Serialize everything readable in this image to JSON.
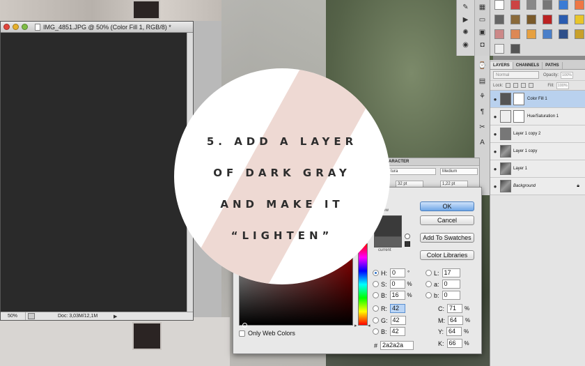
{
  "document": {
    "title": "IMG_4851.JPG @ 50% (Color Fill 1, RGB/8) *",
    "zoom": "50%",
    "doc_info": "Doc: 3,03M/12,1M"
  },
  "layers_panel": {
    "tabs": [
      "LAYERS",
      "CHANNELS",
      "PATHS"
    ],
    "blend_mode": "Normal",
    "opacity_label": "Opacity:",
    "opacity_value": "100%",
    "lock_label": "Lock:",
    "fill_label": "Fill:",
    "fill_value": "100%",
    "layers": [
      {
        "name": "Color Fill 1",
        "selected": true
      },
      {
        "name": "Hue/Saturation 1",
        "selected": false
      },
      {
        "name": "Layer 1 copy 2",
        "selected": false
      },
      {
        "name": "Layer 1 copy",
        "selected": false
      },
      {
        "name": "Layer 1",
        "selected": false
      },
      {
        "name": "Background",
        "selected": false
      }
    ]
  },
  "character_panel": {
    "title": "ARACTER",
    "font": "tura",
    "style": "Medium",
    "size": "32 pt",
    "leading": "1,22 pt"
  },
  "color_picker": {
    "new_label": "new",
    "current_label": "current",
    "ok": "OK",
    "cancel": "Cancel",
    "add_to_swatches": "Add To Swatches",
    "color_libraries": "Color Libraries",
    "only_web_colors": "Only Web Colors",
    "h": {
      "label": "H:",
      "value": "0",
      "unit": "°"
    },
    "s": {
      "label": "S:",
      "value": "0",
      "unit": "%"
    },
    "b": {
      "label": "B:",
      "value": "16",
      "unit": "%"
    },
    "r": {
      "label": "R:",
      "value": "42"
    },
    "g": {
      "label": "G:",
      "value": "42"
    },
    "bl": {
      "label": "B:",
      "value": "42"
    },
    "l": {
      "label": "L:",
      "value": "17"
    },
    "a": {
      "label": "a:",
      "value": "0"
    },
    "lb": {
      "label": "b:",
      "value": "0"
    },
    "c": {
      "label": "C:",
      "value": "71",
      "unit": "%"
    },
    "m": {
      "label": "M:",
      "value": "64",
      "unit": "%"
    },
    "y": {
      "label": "Y:",
      "value": "64",
      "unit": "%"
    },
    "k": {
      "label": "K:",
      "value": "66",
      "unit": "%"
    },
    "hex_label": "#",
    "hex": "2a2a2a"
  },
  "overlay": {
    "line1": "5. ADD A LAYER",
    "line2": "OF DARK GRAY",
    "line3": "AND MAKE IT",
    "line4": "“LIGHTEN”"
  },
  "colors": {
    "fill": "#2a2a2a",
    "selection": "#b9d1ee",
    "stripe": "#eed9d3"
  }
}
